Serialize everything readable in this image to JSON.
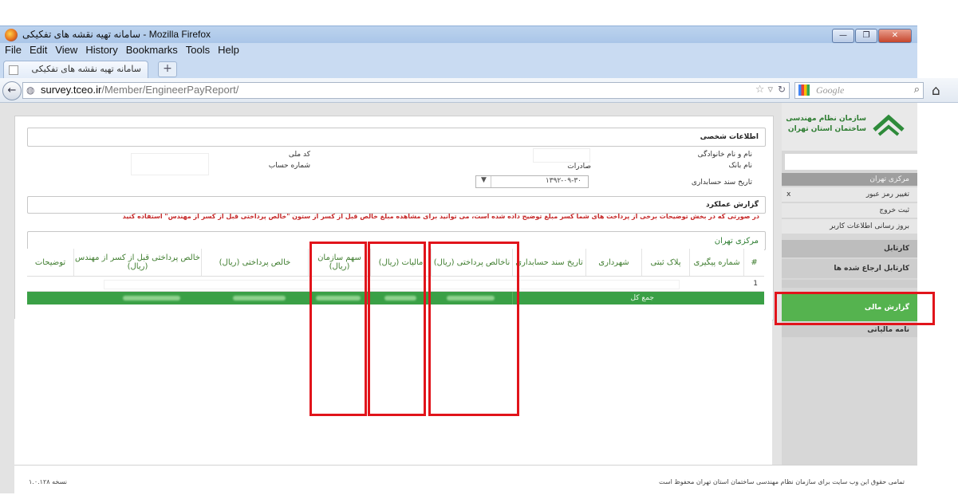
{
  "window": {
    "title": "سامانه تهیه نقشه های تفکیکی - Mozilla Firefox",
    "min": "—",
    "max": "❐",
    "close": "✕"
  },
  "menu": [
    "File",
    "Edit",
    "View",
    "History",
    "Bookmarks",
    "Tools",
    "Help"
  ],
  "tab": {
    "label": "سامانه تهیه نقشه های تفکیکی",
    "new": "+"
  },
  "nav": {
    "back": "←",
    "url_host": "survey.tceo.ir",
    "url_path": "/Member/EngineerPayReport/",
    "search_placeholder": "Google",
    "search_icon": "⌕",
    "home_icon": "⌂"
  },
  "personal": {
    "section_title": "اطلاعات شخصی",
    "fullname_label": "نام و نام خانوادگی",
    "national_code_label": "کد ملی",
    "bank_label": "نام بانک",
    "bank_value": "صادرات",
    "account_label": "شماره حساب",
    "doc_date_label": "تاریخ سند حسابداری",
    "doc_date_value": "۱۳۹۲-۰۹-۳۰"
  },
  "report": {
    "section_title": "گزارش عملکرد",
    "notice": "در صورتی که در بخش توضیحات برخی از پرداخت های شما کسر مبلغ توضیح داده شده است، می توانید برای مشاهده مبلغ خالص قبل از کسر از ستون \"خالص پرداختی قبل از کسر از مهندس\" استفاده کنید",
    "region": "مرکزی تهران",
    "columns": [
      "#",
      "شماره پیگیری",
      "پلاک ثبتی",
      "شهرداری",
      "تاریخ سند حسابداری",
      "ناخالص پرداختی (ریال)",
      "مالیات (ریال)",
      "سهم سازمان (ریال)",
      "خالص پرداختی (ریال)",
      "خالص پرداختی قبل از کسر از مهندس (ریال)",
      "توضیحات"
    ],
    "row_index": "1",
    "total_label": "جمع کل"
  },
  "sidebar": {
    "org_name_1": "سازمان نظام مهندسی",
    "org_name_2": "ساختمان استان تهران",
    "region": "مرکزی تهران",
    "change_password": "تغییر رمز عبور",
    "close_x": "x",
    "logout": "ثبت خروج",
    "update_info": "بروز رسانی اطلاعات کاربر",
    "cartable": "کارتابل",
    "referred_cartable": "کارتابل ارجاع شده ها",
    "financial_report": "گزارش مالی",
    "tax_letter": "نامه مالیاتی"
  },
  "footer": {
    "copyright": "تمامی حقوق این وب سایت برای سازمان نظام مهندسی ساختمان استان تهران محفوظ است",
    "version": "نسخه ۱.۰.۱۲۸"
  },
  "colors": {
    "accent_green": "#3aa046",
    "highlight_red": "#e1141b",
    "chrome_blue": "#c9dbf2"
  }
}
